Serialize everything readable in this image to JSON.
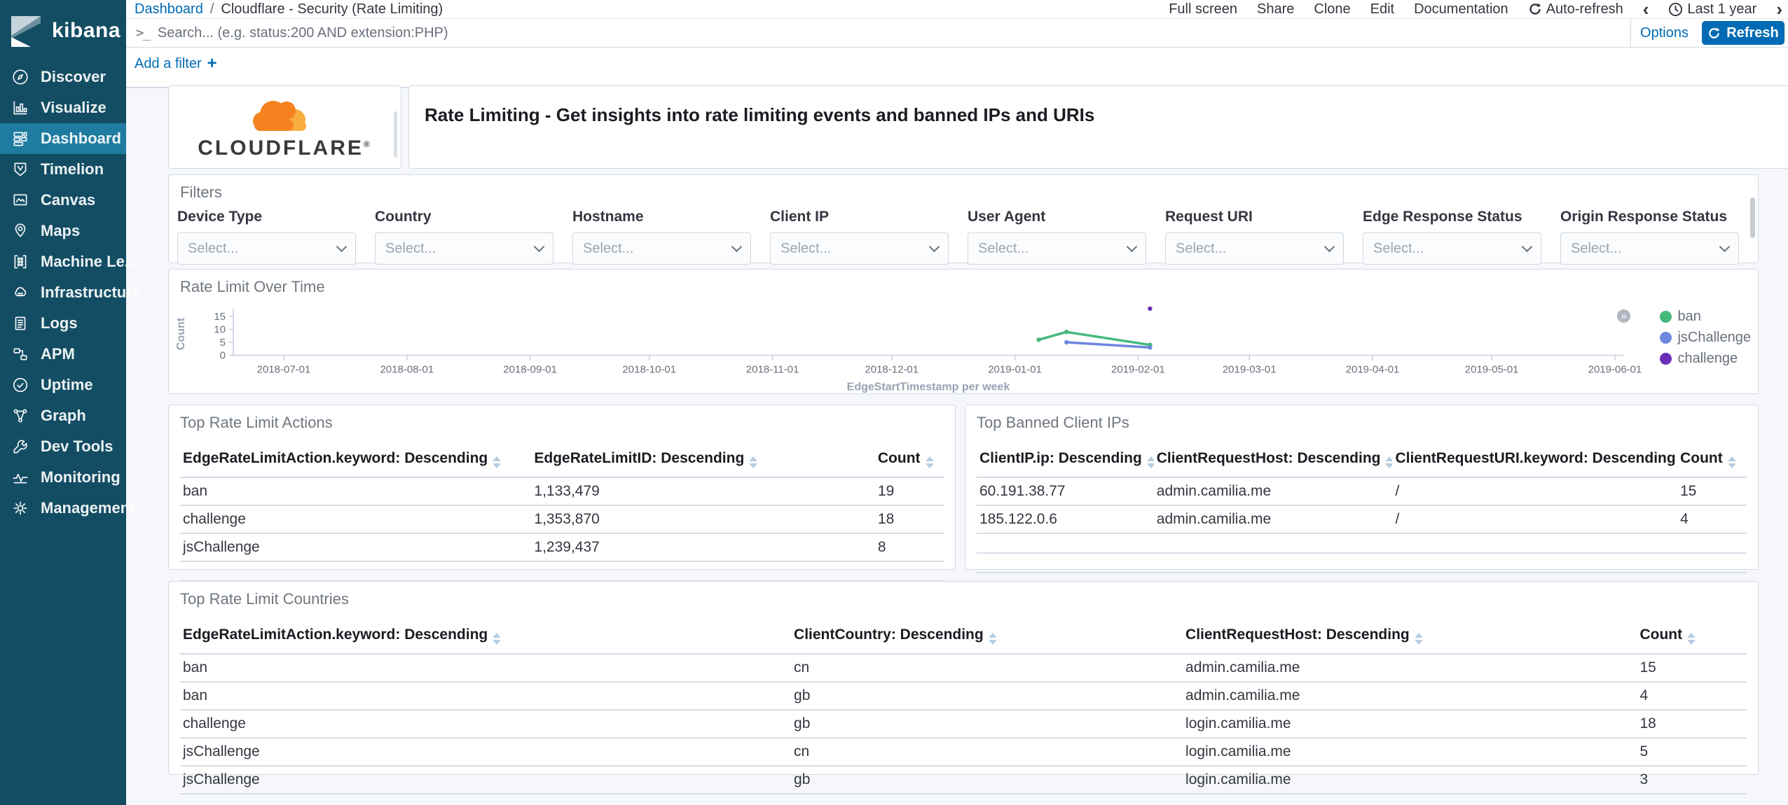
{
  "sidebar": {
    "logo_text": "kibana",
    "items": [
      {
        "label": "Discover",
        "icon": "discover-icon",
        "active": false
      },
      {
        "label": "Visualize",
        "icon": "visualize-icon",
        "active": false
      },
      {
        "label": "Dashboard",
        "icon": "dashboard-icon",
        "active": true
      },
      {
        "label": "Timelion",
        "icon": "timelion-icon",
        "active": false
      },
      {
        "label": "Canvas",
        "icon": "canvas-icon",
        "active": false
      },
      {
        "label": "Maps",
        "icon": "maps-icon",
        "active": false
      },
      {
        "label": "Machine Le...",
        "icon": "machine-learning-icon",
        "active": false
      },
      {
        "label": "Infrastructure",
        "icon": "infrastructure-icon",
        "active": false
      },
      {
        "label": "Logs",
        "icon": "logs-icon",
        "active": false
      },
      {
        "label": "APM",
        "icon": "apm-icon",
        "active": false
      },
      {
        "label": "Uptime",
        "icon": "uptime-icon",
        "active": false
      },
      {
        "label": "Graph",
        "icon": "graph-icon",
        "active": false
      },
      {
        "label": "Dev Tools",
        "icon": "dev-tools-icon",
        "active": false
      },
      {
        "label": "Monitoring",
        "icon": "monitoring-icon",
        "active": false
      },
      {
        "label": "Management",
        "icon": "management-icon",
        "active": false
      }
    ]
  },
  "topnav": {
    "breadcrumb": {
      "root": "Dashboard",
      "separator": "/",
      "current": "Cloudflare - Security (Rate Limiting)"
    },
    "menu": [
      "Full screen",
      "Share",
      "Clone",
      "Edit",
      "Documentation"
    ],
    "auto_refresh_label": "Auto-refresh",
    "time_range": "Last 1 year"
  },
  "icons": {
    "prev": "‹",
    "next": "›",
    "legend_expand": "»",
    "plus": "+",
    "terminal_prompt": ">_"
  },
  "search": {
    "placeholder": "Search... (e.g. status:200 AND extension:PHP)",
    "options_label": "Options",
    "refresh_label": "Refresh"
  },
  "filter_bar": {
    "add_filter_label": "Add a filter"
  },
  "banner": {
    "brand": "CLOUDFLARE",
    "brand_mark": "®",
    "title": "Rate Limiting - Get insights into rate limiting events and banned IPs and URIs"
  },
  "filters": {
    "title": "Filters",
    "placeholder": "Select...",
    "fields": [
      "Device Type",
      "Country",
      "Hostname",
      "Client IP",
      "User Agent",
      "Request URI",
      "Edge Response Status",
      "Origin Response Status"
    ]
  },
  "chart_data": {
    "type": "line",
    "title": "Rate Limit Over Time",
    "xlabel": "EdgeStartTimestamp per week",
    "ylabel": "Count",
    "ylim": [
      0,
      15
    ],
    "yticks": [
      0,
      5,
      10,
      15
    ],
    "xticks": [
      "2018-07-01",
      "2018-08-01",
      "2018-09-01",
      "2018-10-01",
      "2018-11-01",
      "2018-12-01",
      "2019-01-01",
      "2019-02-01",
      "2019-03-01",
      "2019-04-01",
      "2019-05-01",
      "2019-06-01"
    ],
    "grid": false,
    "legend_position": "right",
    "series": [
      {
        "name": "ban",
        "color": "#45b97c",
        "points": [
          {
            "x": "2019-01-07",
            "y": 6
          },
          {
            "x": "2019-01-14",
            "y": 9
          },
          {
            "x": "2019-02-04",
            "y": 4
          }
        ]
      },
      {
        "name": "jsChallenge",
        "color": "#6d87e0",
        "points": [
          {
            "x": "2019-01-14",
            "y": 5
          },
          {
            "x": "2019-02-04",
            "y": 3
          }
        ]
      },
      {
        "name": "challenge",
        "color": "#6a2eb8",
        "points": [
          {
            "x": "2019-02-04",
            "y": 18
          }
        ]
      }
    ]
  },
  "tables": {
    "actions": {
      "title": "Top Rate Limit Actions",
      "headers": [
        "EdgeRateLimitAction.keyword: Descending",
        "EdgeRateLimitID: Descending",
        "Count"
      ],
      "rows": [
        [
          "ban",
          "1,133,479",
          "19"
        ],
        [
          "challenge",
          "1,353,870",
          "18"
        ],
        [
          "jsChallenge",
          "1,239,437",
          "8"
        ]
      ],
      "empty_rows": 1
    },
    "banned_ips": {
      "title": "Top Banned Client IPs",
      "headers": [
        "ClientIP.ip: Descending",
        "ClientRequestHost: Descending",
        "ClientRequestURI.keyword: Descending",
        "Count"
      ],
      "rows": [
        [
          "60.191.38.77",
          "admin.camilia.me",
          "/",
          "15"
        ],
        [
          "185.122.0.6",
          "admin.camilia.me",
          "/",
          "4"
        ]
      ],
      "empty_rows": 2
    },
    "countries": {
      "title": "Top Rate Limit Countries",
      "headers": [
        "EdgeRateLimitAction.keyword: Descending",
        "ClientCountry: Descending",
        "ClientRequestHost: Descending",
        "Count"
      ],
      "rows": [
        [
          "ban",
          "cn",
          "admin.camilia.me",
          "15"
        ],
        [
          "ban",
          "gb",
          "admin.camilia.me",
          "4"
        ],
        [
          "challenge",
          "gb",
          "login.camilia.me",
          "18"
        ],
        [
          "jsChallenge",
          "cn",
          "login.camilia.me",
          "5"
        ],
        [
          "jsChallenge",
          "gb",
          "login.camilia.me",
          "3"
        ]
      ],
      "empty_rows": 0
    }
  }
}
